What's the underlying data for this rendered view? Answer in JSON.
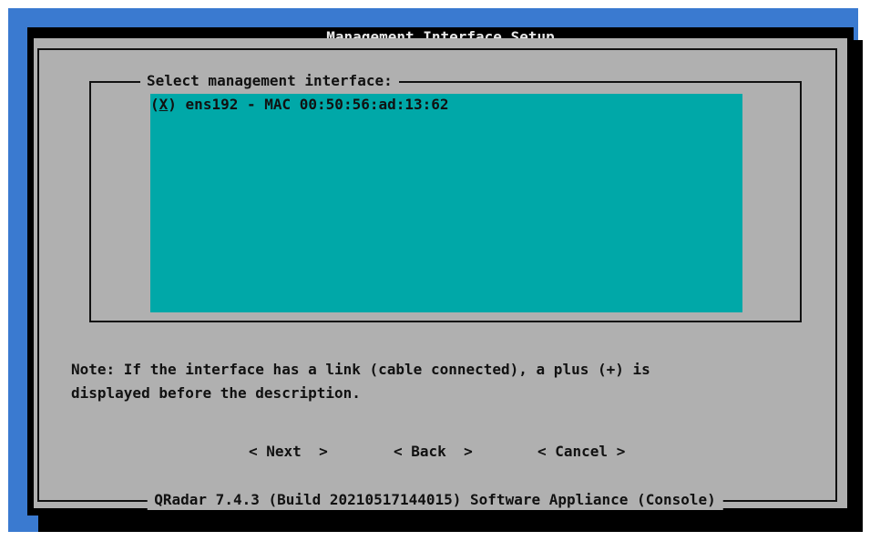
{
  "dialog": {
    "title": "Management Interface Setup",
    "list_label": "Select management interface:",
    "interfaces": [
      {
        "marker": "X",
        "label": "ens192 - MAC 00:50:56:ad:13:62",
        "selected": true
      }
    ],
    "note_line1": "Note: If the interface has a link (cable connected), a plus (+) is",
    "note_line2": "displayed before the description.",
    "buttons": {
      "next": "< Next  >",
      "back": "< Back  >",
      "cancel": "< Cancel >"
    },
    "footer": "QRadar 7.4.3 (Build 20210517144015) Software Appliance (Console)"
  },
  "colors": {
    "desktop": "#3a7ad0",
    "dialog_face": "#b0b0b0",
    "list_bg": "#00a8a8",
    "shadow": "#000000"
  }
}
